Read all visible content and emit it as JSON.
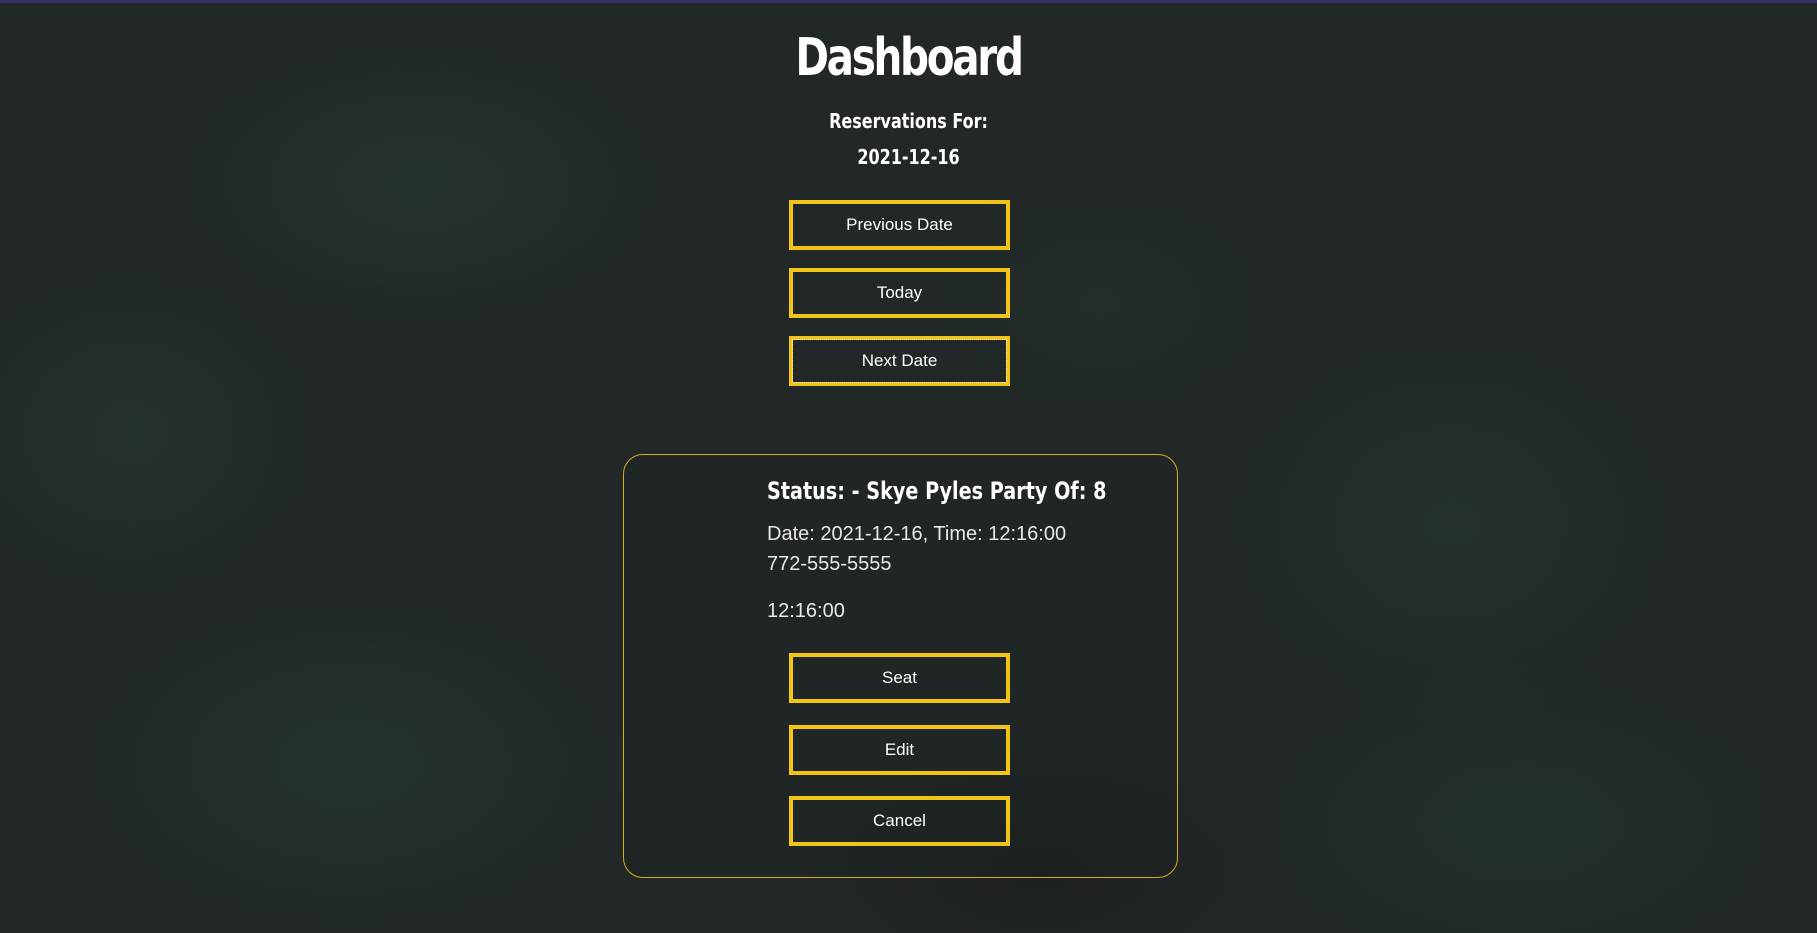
{
  "page": {
    "title": "Dashboard",
    "subtitle": "Reservations For:",
    "current_date": "2021-12-16"
  },
  "nav": {
    "previous_label": "Previous Date",
    "today_label": "Today",
    "next_label": "Next Date"
  },
  "reservation": {
    "heading": "Status: - Skye Pyles Party Of: 8",
    "datetime_line": "Date: 2021-12-16, Time: 12:16:00",
    "phone": "772-555-5555",
    "time": "12:16:00",
    "seat_label": "Seat",
    "edit_label": "Edit",
    "cancel_label": "Cancel"
  },
  "colors": {
    "accent": "#f2c417",
    "background": "#222827",
    "text": "#ffffff"
  }
}
